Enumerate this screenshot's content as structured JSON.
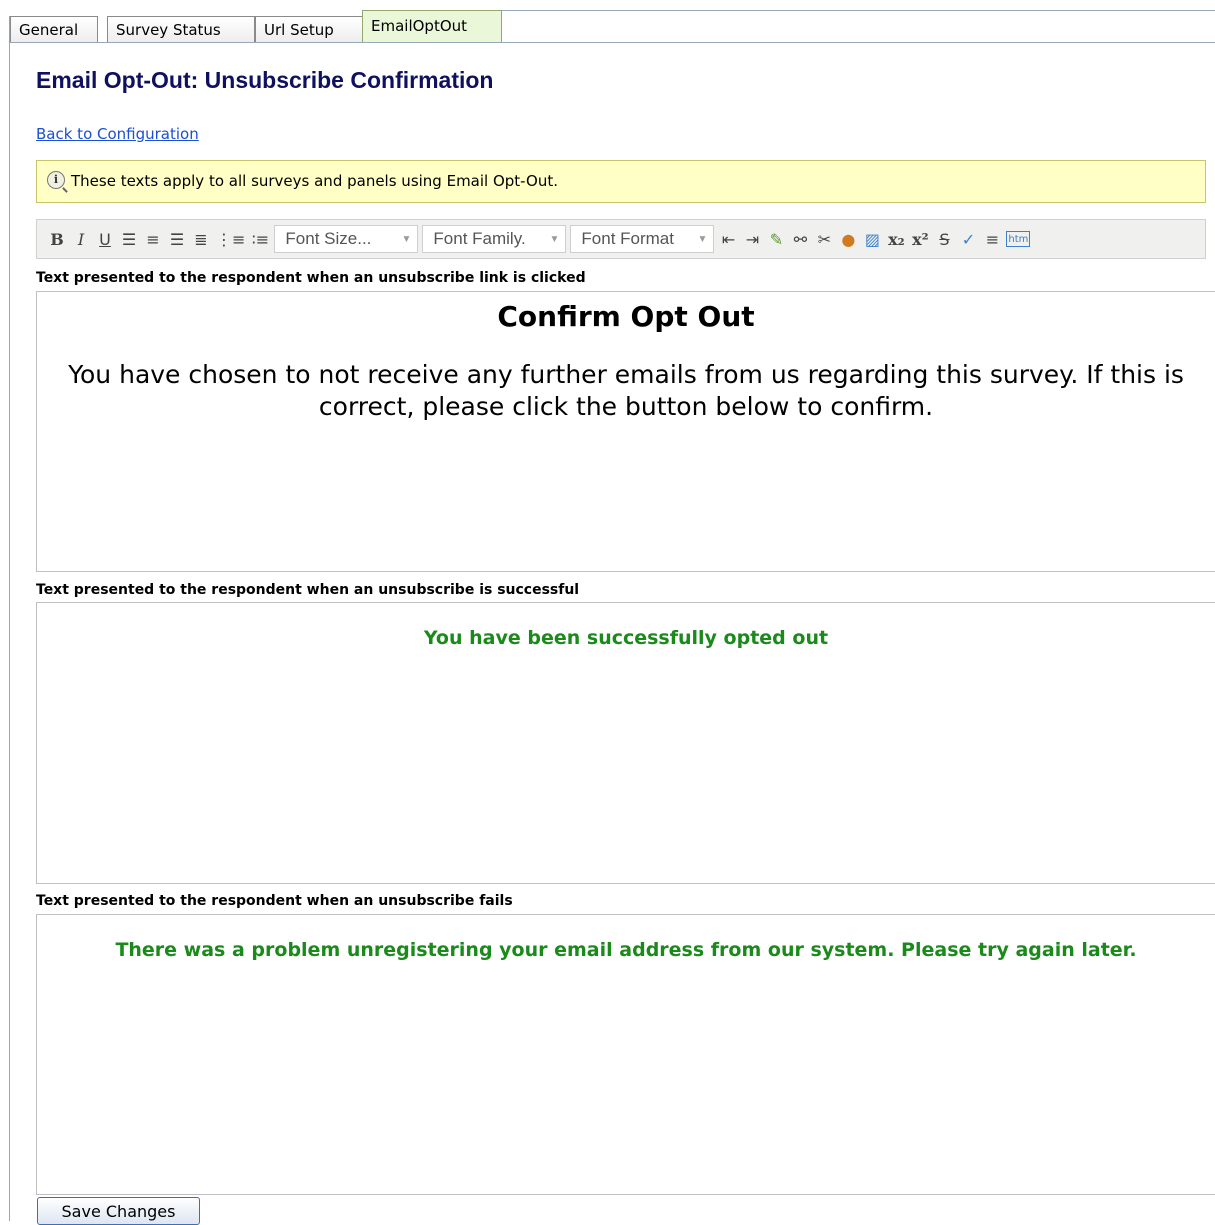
{
  "tabs": [
    {
      "label": "General"
    },
    {
      "label": "Survey Status"
    },
    {
      "label": "Url Setup"
    },
    {
      "label": "EmailOptOut",
      "active": true
    }
  ],
  "page": {
    "title": "Email Opt-Out: Unsubscribe Confirmation",
    "back_link": "Back to Configuration",
    "info_text": "These texts apply to all surveys and panels using Email Opt-Out."
  },
  "toolbar": {
    "font_size": "Font Size...",
    "font_family": "Font Family.",
    "font_format": "Font Format",
    "icons": [
      "bold-icon",
      "italic-icon",
      "underline-icon",
      "align-left-icon",
      "align-center-icon",
      "align-right-icon",
      "align-justify-icon",
      "ordered-list-icon",
      "unordered-list-icon",
      "outdent-icon",
      "indent-icon",
      "edit-icon",
      "link-icon",
      "unlink-icon",
      "image-icon",
      "template-icon",
      "subscript-icon",
      "superscript-icon",
      "strikethrough-icon",
      "spellcheck-icon",
      "horizontal-rule-icon",
      "html-icon"
    ]
  },
  "editors": {
    "clicked": {
      "label": "Text presented to the respondent when an unsubscribe link is clicked",
      "heading": "Confirm Opt Out",
      "body": "You have chosen to not receive any further emails from us regarding this survey. If this is correct, please click the button below to confirm."
    },
    "success": {
      "label": "Text presented to the respondent when an unsubscribe is successful",
      "body": "You have been successfully opted out"
    },
    "fail": {
      "label": "Text presented to the respondent when an unsubscribe fails",
      "body": "There was a problem unregistering your email address from our system. Please try again later."
    }
  },
  "actions": {
    "save_label": "Save Changes"
  },
  "colors": {
    "title": "#101060",
    "link": "#1a4fd6",
    "info_bg": "#ffffc6",
    "success_text": "#1a8a1a"
  }
}
